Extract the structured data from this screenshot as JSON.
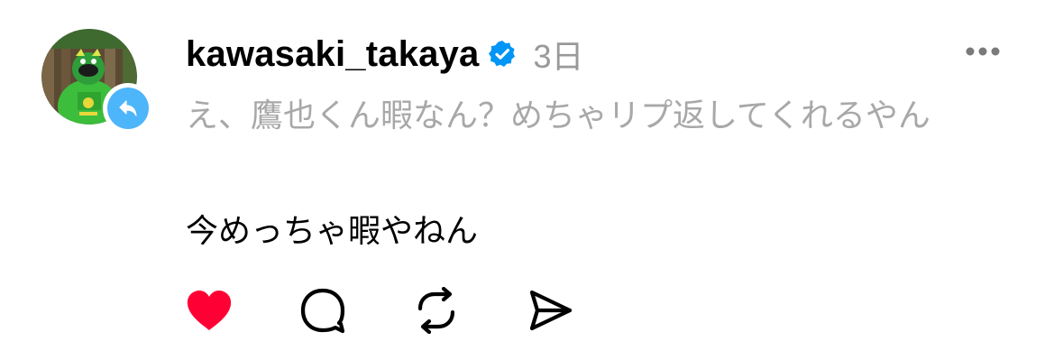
{
  "post": {
    "username": "kawasaki_takaya",
    "verified": true,
    "timestamp": "3日",
    "quoted_text": "え、鷹也くん暇なん？めちゃリプ返してくれるやん",
    "body_text": "今めっちゃ暇やねん",
    "liked": true
  },
  "icons": {
    "more": "more-horizontal-icon",
    "reply_badge": "reply-arrow-icon",
    "verified": "verified-badge-icon",
    "like": "heart-icon",
    "comment": "comment-bubble-icon",
    "repost": "repost-icon",
    "share": "send-icon"
  },
  "colors": {
    "like": "#ff0034",
    "verified": "#0095f6",
    "reply_badge": "#4db5f9",
    "muted_text": "#a8a8a8",
    "timestamp": "#999999"
  }
}
